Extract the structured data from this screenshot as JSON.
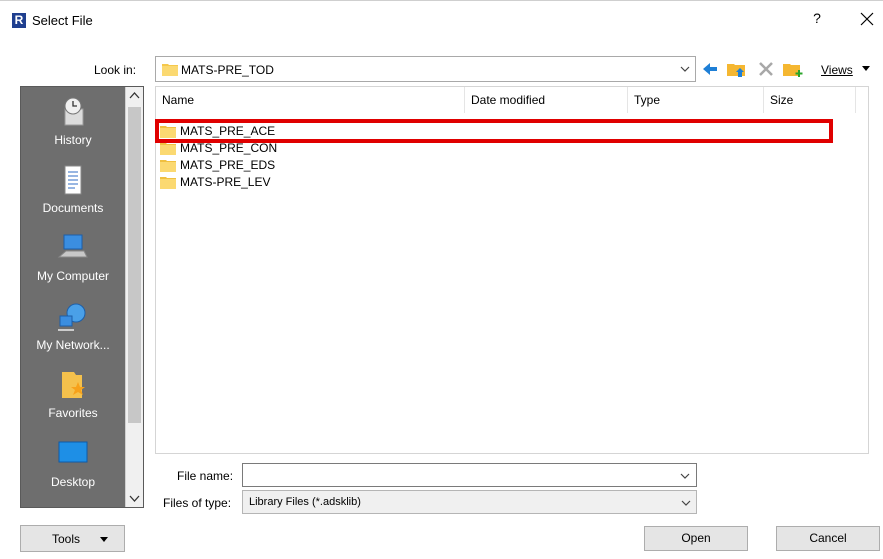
{
  "window": {
    "logo_letter": "R",
    "title": "Select File",
    "help_label": "?",
    "close_icon": "close-icon"
  },
  "lookin": {
    "label": "Look in:",
    "value": "MATS-PRE_TOD"
  },
  "toolbar": {
    "views_label": "Views",
    "icons": [
      "back-arrow-icon",
      "up-folder-icon",
      "delete-icon",
      "new-folder-icon"
    ]
  },
  "places": [
    {
      "label": "History",
      "icon": "history-icon"
    },
    {
      "label": "Documents",
      "icon": "documents-icon"
    },
    {
      "label": "My Computer",
      "icon": "computer-icon"
    },
    {
      "label": "My Network...",
      "icon": "network-icon"
    },
    {
      "label": "Favorites",
      "icon": "favorites-icon"
    },
    {
      "label": "Desktop",
      "icon": "desktop-icon"
    }
  ],
  "columns": [
    "Name",
    "Date modified",
    "Type",
    "Size"
  ],
  "files": [
    {
      "name": "MATS_PRE_ACE"
    },
    {
      "name": "MATS_PRE_CON"
    },
    {
      "name": "MATS_PRE_EDS"
    },
    {
      "name": "MATS-PRE_LEV"
    }
  ],
  "filename": {
    "label": "File name:",
    "value": "",
    "placeholder": ""
  },
  "filetype": {
    "label": "Files of type:",
    "value": "Library Files  (*.adsklib)"
  },
  "buttons": {
    "tools": "Tools",
    "open": "Open",
    "cancel": "Cancel"
  },
  "colors": {
    "highlight": "#e00000",
    "places_bg": "#6e6e6e",
    "folder": "#f5c84c"
  }
}
